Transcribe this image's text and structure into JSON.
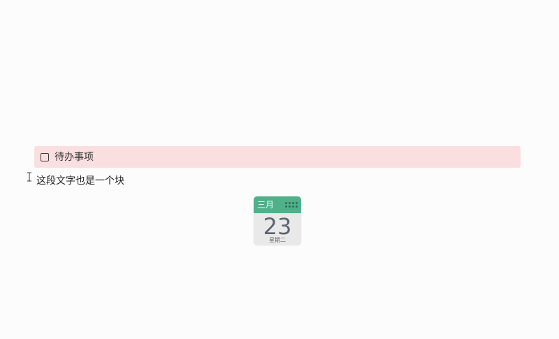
{
  "todo": {
    "checked": false,
    "text": "待办事项",
    "highlight_color": "#fadfe0"
  },
  "paragraph": {
    "text": "这段文字也是一个块"
  },
  "calendar": {
    "month": "三月",
    "day": "23",
    "weekday": "星期二",
    "header_color": "#4fb08a"
  },
  "cursor": {
    "icon": "text-ibeam-cursor-icon"
  }
}
